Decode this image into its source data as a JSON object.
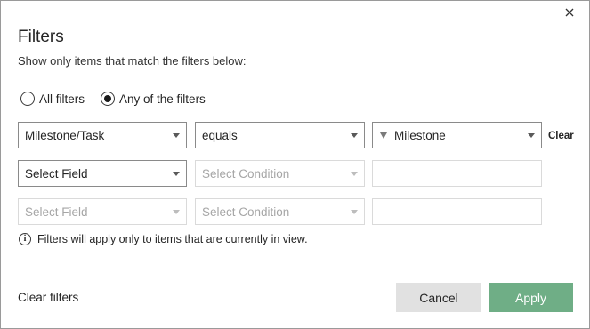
{
  "dialog": {
    "title": "Filters",
    "subtitle": "Show only items that match the filters below:",
    "close_icon": "close-icon"
  },
  "match_mode": {
    "options": [
      {
        "label": "All filters",
        "selected": false
      },
      {
        "label": "Any of the filters",
        "selected": true
      }
    ]
  },
  "rows": [
    {
      "field": {
        "value": "Milestone/Task",
        "disabled": false
      },
      "condition": {
        "value": "equals",
        "disabled": false
      },
      "value": {
        "value": "Milestone",
        "icon": "funnel-icon",
        "disabled": false
      },
      "clear_label": "Clear"
    },
    {
      "field": {
        "value": "Select Field",
        "disabled": false
      },
      "condition": {
        "value": "Select Condition",
        "disabled": true
      },
      "value": {
        "value": "",
        "disabled": true
      }
    },
    {
      "field": {
        "value": "Select Field",
        "disabled": true
      },
      "condition": {
        "value": "Select Condition",
        "disabled": true
      },
      "value": {
        "value": "",
        "disabled": true
      }
    }
  ],
  "info": {
    "icon": "info-icon",
    "text": "Filters will apply only to items that are currently in view."
  },
  "footer": {
    "clear_filters_label": "Clear filters",
    "cancel_label": "Cancel",
    "apply_label": "Apply"
  },
  "colors": {
    "apply_button": "#6fae86",
    "cancel_button": "#e1e1e1",
    "disabled_text": "#a6a6a6"
  }
}
